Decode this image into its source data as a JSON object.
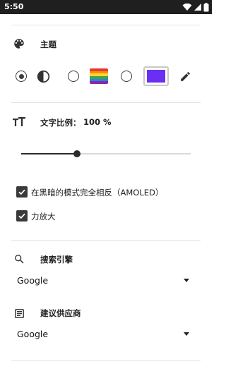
{
  "status_bar": {
    "time": "5:50"
  },
  "theme": {
    "title": "主题",
    "options": [
      {
        "id": "auto",
        "selected": true
      },
      {
        "id": "pride",
        "selected": false
      },
      {
        "id": "custom",
        "selected": false
      }
    ],
    "custom_color": "#6a2ff3",
    "rainbow_colors": [
      "#e53935",
      "#fb8c00",
      "#fdd835",
      "#43a047",
      "#1e88e5",
      "#8e24aa"
    ]
  },
  "text_scale": {
    "label": "文字比例：",
    "value": "100 %",
    "slider_fraction": 0.33
  },
  "options": {
    "amoled_label": "在黑暗的模式完全相反（AMOLED）",
    "amoled_checked": true,
    "zoom_label": "力放大",
    "zoom_checked": true
  },
  "search_engine": {
    "title": "搜索引擎",
    "value": "Google"
  },
  "suggestion_provider": {
    "title": "建议供应商",
    "value": "Google"
  },
  "colors": {
    "accent": "#2b2b2b",
    "status_bar": "#1f1f1f"
  }
}
